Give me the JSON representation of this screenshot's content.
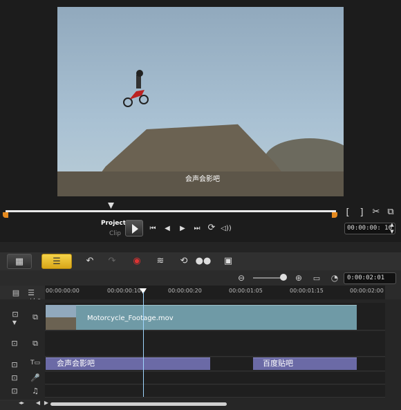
{
  "preview": {
    "subtitle": "会声会影吧",
    "mode_project": "Project",
    "mode_clip": "Clip",
    "timecode": "00:00:00: 16",
    "controls": {
      "mark_in": "[",
      "mark_out": "]",
      "prev": "⏮",
      "step_back": "◀",
      "step_fwd": "▶",
      "next": "⏭",
      "repeat": "⟳",
      "volume": "🔊"
    }
  },
  "toolbar": {
    "storyboard_icon": "film-icon",
    "timeline_icon": "timeline-icon",
    "tools": [
      "undo-icon",
      "redo-icon",
      "record-icon",
      "audio-wave-icon",
      "smart-proxy-icon",
      "track-manager-icon",
      "subtitle-icon"
    ]
  },
  "zoom": {
    "timecode": "0:00:02:01",
    "level_fraction": 0.85
  },
  "ruler": {
    "labels": [
      "00:00:00:00",
      "00:00:00:10",
      "00:00:00:20",
      "00:00:01:05",
      "00:00:01:15",
      "00:00:02:00"
    ]
  },
  "tracks": {
    "video_clip_label": "Motorcycle_Footage.mov",
    "title_clip_1": "会声会影吧",
    "title_clip_2": "百度贴吧"
  },
  "colors": {
    "accent": "#e58a1f",
    "timeline_active": "#e8be2a",
    "video_clip": "#6f9aa6",
    "title_clip": "#6b6aa6"
  }
}
